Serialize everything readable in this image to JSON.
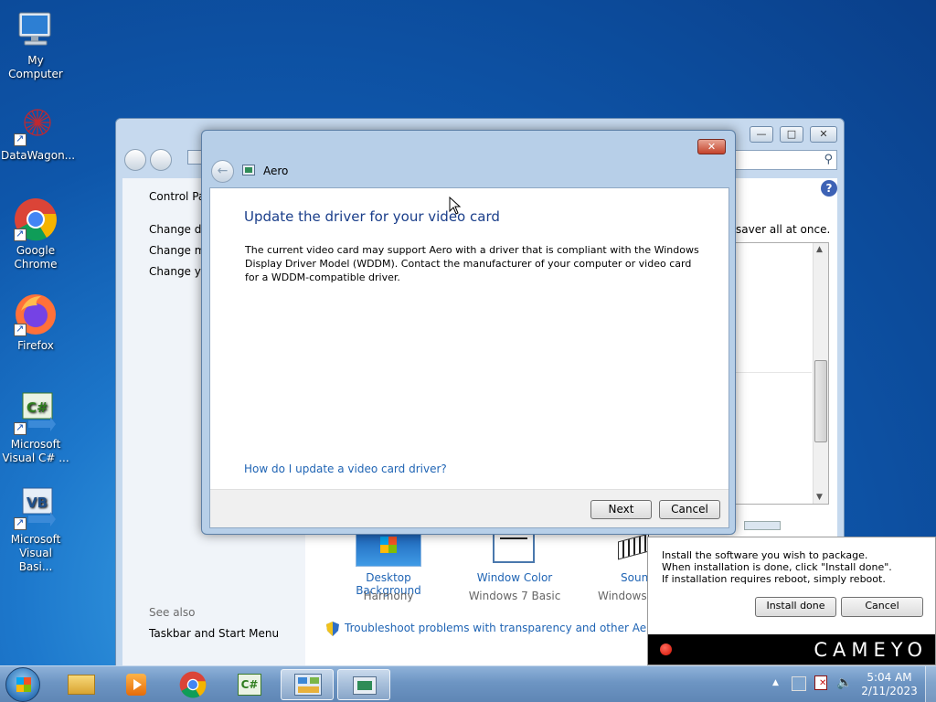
{
  "desktop": {
    "icons": [
      {
        "label": "My Computer"
      },
      {
        "label": "DataWagon..."
      },
      {
        "label": "Google Chrome"
      },
      {
        "label": "Firefox"
      },
      {
        "label": "Microsoft Visual C# ..."
      },
      {
        "label": "Microsoft Visual Basi..."
      }
    ]
  },
  "personalization_window": {
    "left_links": [
      "Control Pa",
      "Change de",
      "Change mo",
      "Change yo"
    ],
    "right_snippet": "saver all at once.",
    "see_also": "See also",
    "see_also_link": "Taskbar and Start Menu",
    "items": [
      {
        "label": "Desktop Background",
        "sub": "Harmony"
      },
      {
        "label": "Window Color",
        "sub": "Windows 7 Basic"
      },
      {
        "label": "Sound",
        "sub": "Windows D"
      }
    ],
    "troubleshoot": "Troubleshoot problems with transparency and other Aero effe",
    "controls": {
      "minimize": "—",
      "maximize": "□",
      "close": "✕"
    }
  },
  "aero_dialog": {
    "title": "Aero",
    "heading": "Update the driver for your video card",
    "body": "The current video card may support Aero with a driver that is compliant with the Windows Display Driver Model (WDDM).  Contact the manufacturer of your computer or video card for a WDDM-compatible driver.",
    "help_link": "How do I update a video card driver?",
    "next_label": "Next",
    "cancel_label": "Cancel",
    "close_glyph": "✕"
  },
  "cameyo": {
    "line1": "Install the software you wish to package.",
    "line2": "When installation is done, click \"Install done\".",
    "line3": "If installation requires reboot, simply reboot.",
    "install_done_label": "Install done",
    "cancel_label": "Cancel",
    "brand": "CAMEYO"
  },
  "taskbar": {
    "time": "5:04 AM",
    "date": "2/11/2023"
  }
}
